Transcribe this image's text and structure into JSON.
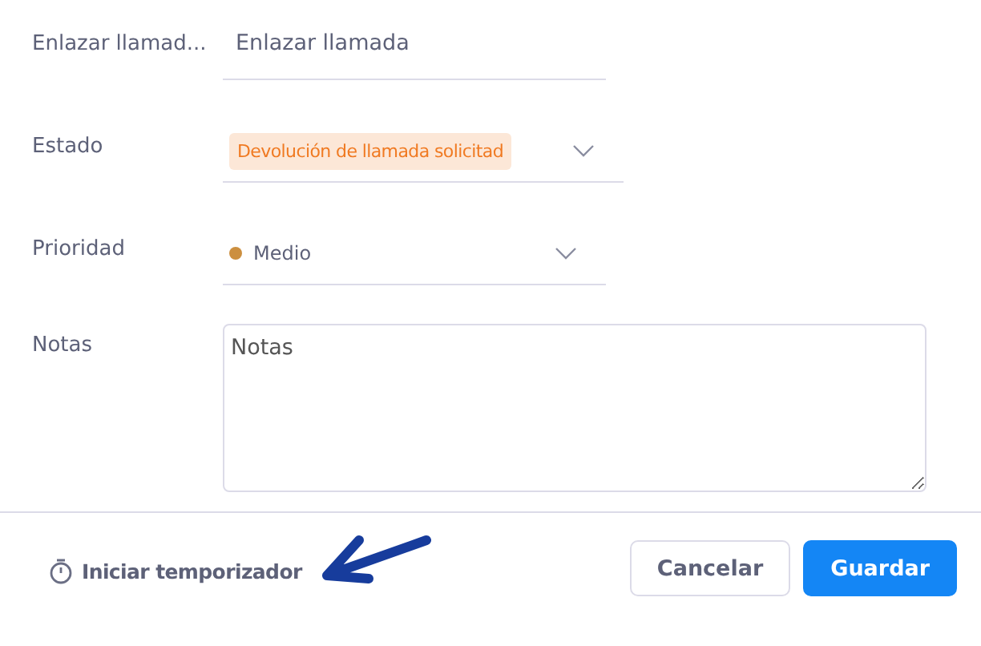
{
  "fields": [
    {
      "kind": "text",
      "label": "Enlazar llamad...",
      "value": "Enlazar llamada"
    },
    {
      "kind": "tag-select",
      "label": "Estado",
      "value": "Devolución de llamada solicitad",
      "color": "#f07a22"
    },
    {
      "kind": "dot-select",
      "label": "Prioridad",
      "value": "Medio",
      "color": "#cc8f3f"
    },
    {
      "kind": "textarea",
      "label": "Notas",
      "value": "Notas"
    }
  ],
  "footer": {
    "timer": "Iniciar temporizador",
    "buttons": [
      {
        "label": "Cancelar",
        "kind": "secondary"
      },
      {
        "label": "Guardar",
        "kind": "primary"
      }
    ]
  },
  "annotation": {
    "kind": "arrow"
  }
}
